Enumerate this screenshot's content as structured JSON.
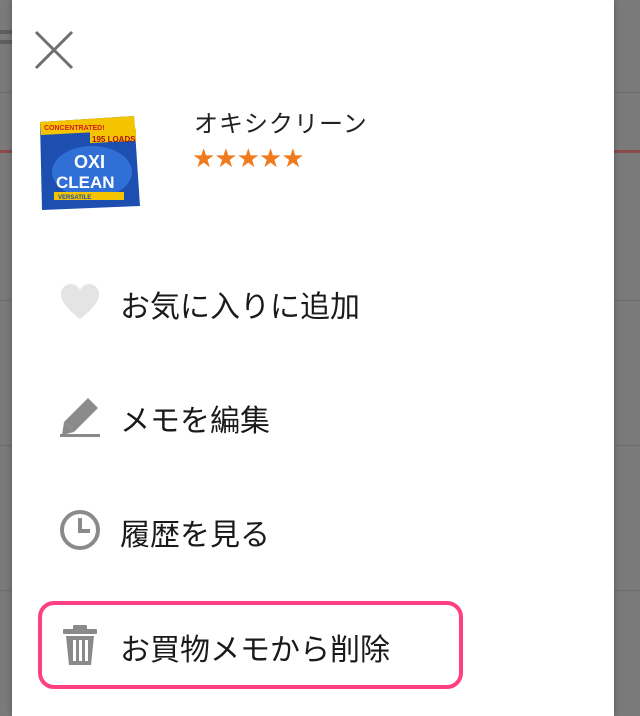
{
  "product": {
    "name": "オキシクリーン",
    "rating": 5,
    "rating_max": 5,
    "stars": "★★★★★",
    "image": {
      "banner": "CONCENTRATED!",
      "loads": "195 LOADS",
      "brand_top": "OXI",
      "brand_bottom": "CLEAN",
      "variant": "VERSATILE"
    }
  },
  "menu": {
    "favorite_label": "お気に入りに追加",
    "edit_memo_label": "メモを編集",
    "history_label": "履歴を見る",
    "delete_label": "お買物メモから削除"
  },
  "colors": {
    "star": "#f07a1e",
    "highlight": "#ff3f83",
    "icon": "#8a8a8a",
    "icon_light": "#e4e4e4"
  }
}
